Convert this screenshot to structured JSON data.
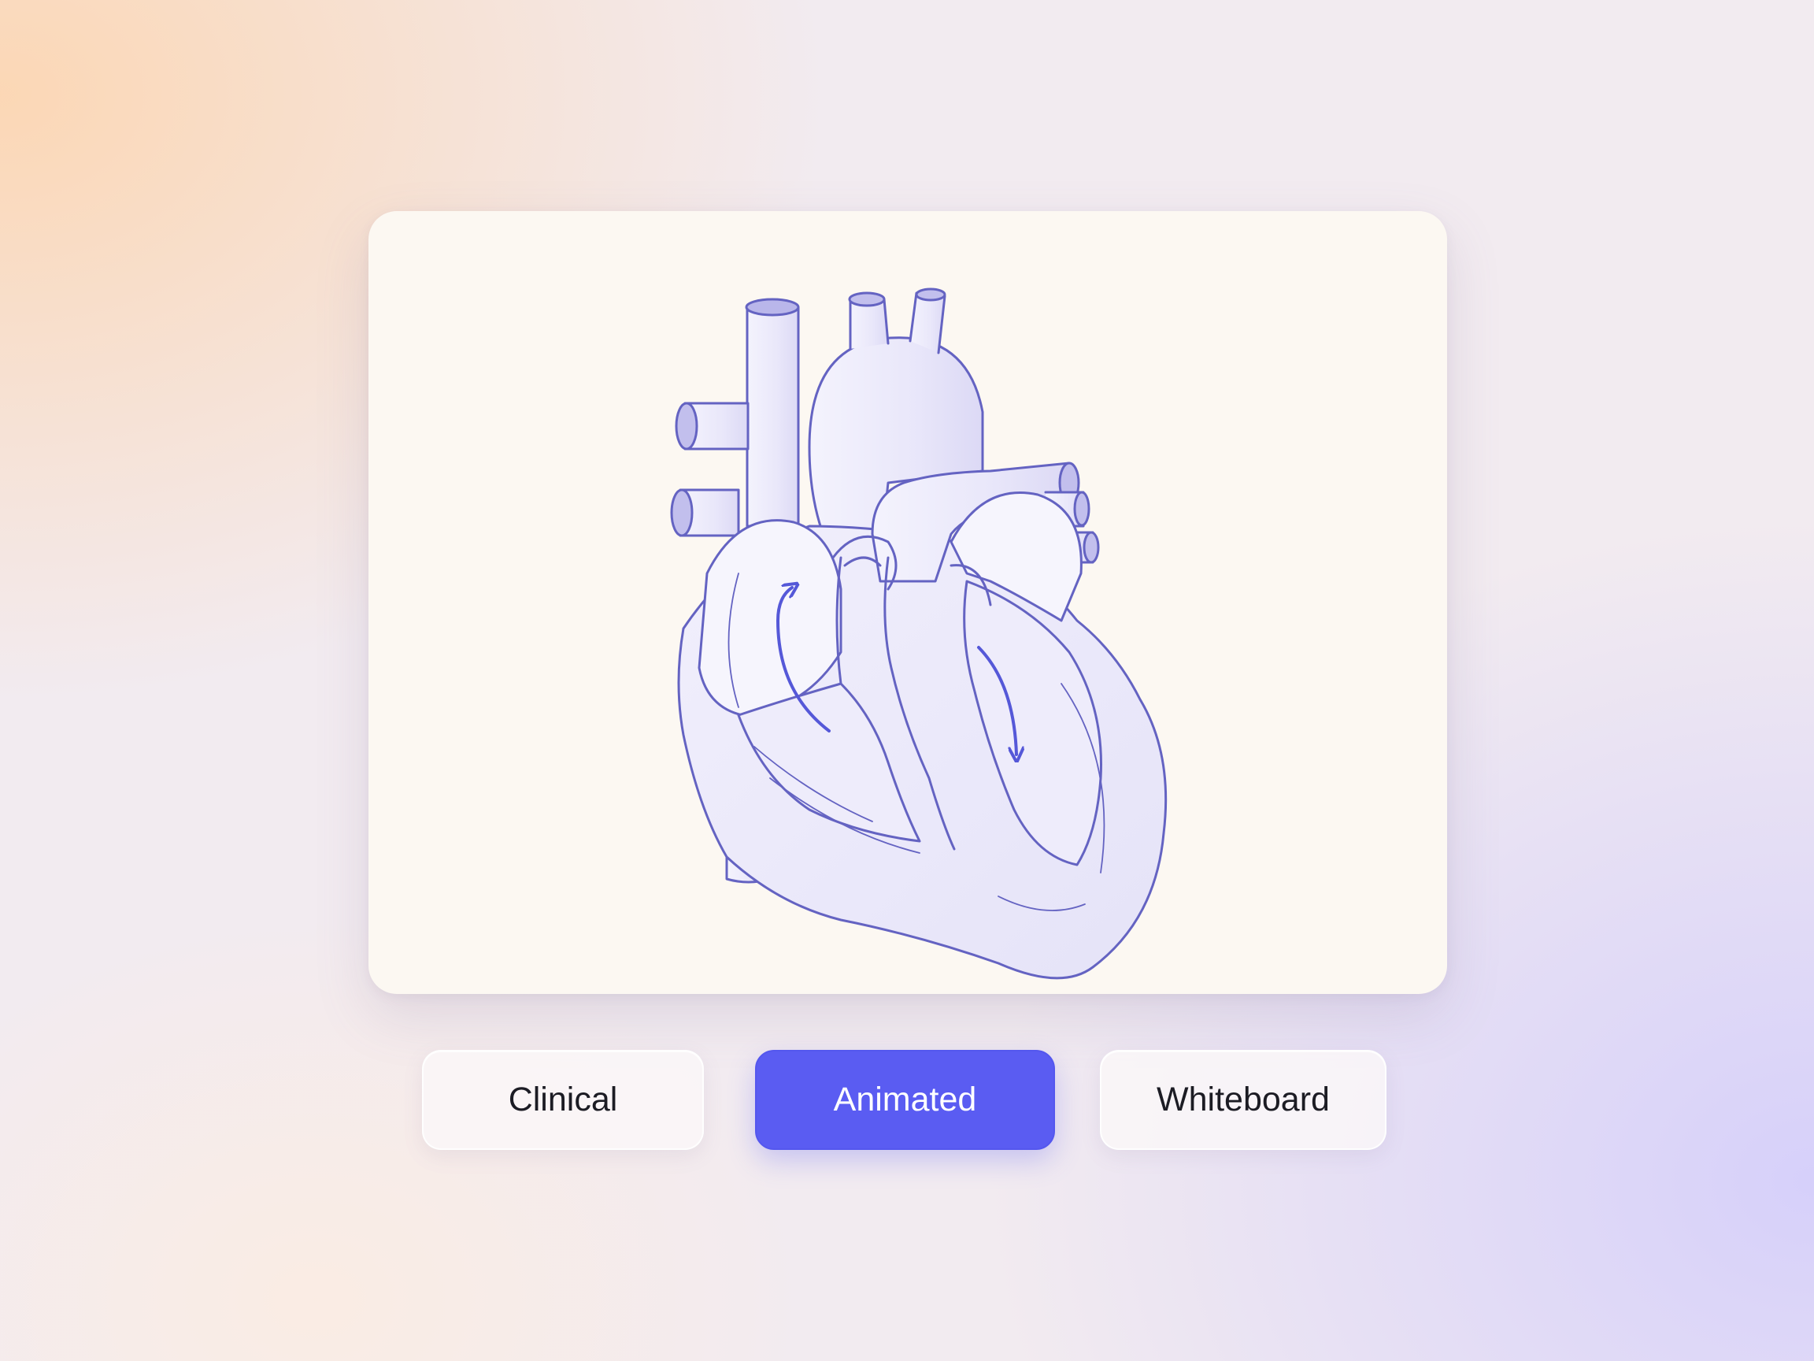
{
  "style_options": {
    "clinical": "Clinical",
    "animated": "Animated",
    "whiteboard": "Whiteboard",
    "selected": "Animated"
  },
  "illustration": {
    "subject": "heart-diagram",
    "arrow_icons": [
      "curved-arrow-up-icon",
      "curved-arrow-down-icon"
    ]
  },
  "colors": {
    "accent": "#5a5cf2",
    "outline": "#5f5fc0",
    "card": "#fcf8f2",
    "heart_fill": "#eceafb"
  }
}
